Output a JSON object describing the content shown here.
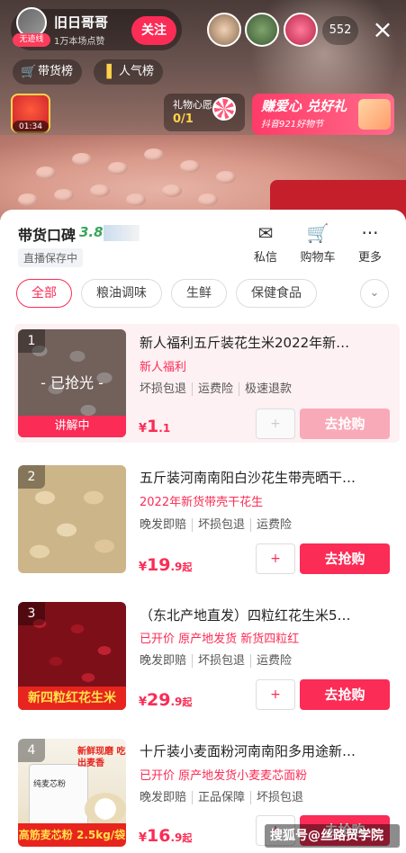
{
  "live": {
    "anchor_name": "旧日哥哥",
    "anchor_badge": "无迹线",
    "fans": "1万本场点赞",
    "follow_label": "关注",
    "viewer_count": "552",
    "close_icon": "×",
    "pills": [
      {
        "label": "带货榜",
        "icon": "cart-icon"
      },
      {
        "label": "人气榜",
        "icon": "bars-icon"
      }
    ],
    "redbag_time": "01:34",
    "wish": {
      "label": "礼物心愿",
      "count": "0/1"
    },
    "promo": {
      "title": "赚爱心 兑好礼",
      "sub": "抖音921好物节"
    }
  },
  "panel": {
    "title": "带货口碑",
    "score": "3.8",
    "subtitle": "直播保存中",
    "tools": [
      {
        "label": "私信",
        "icon": "message-icon",
        "glyph": "✉"
      },
      {
        "label": "购物车",
        "icon": "cart-icon",
        "glyph": "🛒"
      },
      {
        "label": "更多",
        "icon": "more-icon",
        "glyph": "···"
      }
    ],
    "categories": [
      {
        "label": "全部",
        "active": true
      },
      {
        "label": "粮油调味",
        "active": false
      },
      {
        "label": "生鲜",
        "active": false
      },
      {
        "label": "保健食品",
        "active": false
      }
    ],
    "expand_icon": "⌄"
  },
  "products": [
    {
      "index": "1",
      "title": "新人福利五斤装花生米2022年新…",
      "label": "新人福利",
      "tags": [
        "坏损包退",
        "运费险",
        "极速退款"
      ],
      "price_currency": "¥",
      "price_int": "1",
      "price_dec": ".1",
      "price_suffix": "",
      "overlay": "- 已抢光 -",
      "explain": "讲解中",
      "buy_label": "去抢购",
      "sold_out": true,
      "add_icon": "+"
    },
    {
      "index": "2",
      "title": "五斤装河南南阳白沙花生带壳晒干…",
      "label": "2022年新货带壳干花生",
      "tags": [
        "晚发即赔",
        "坏损包退",
        "运费险"
      ],
      "price_currency": "¥",
      "price_int": "19",
      "price_dec": ".9",
      "price_suffix": "起",
      "buy_label": "去抢购",
      "sold_out": false,
      "add_icon": "+"
    },
    {
      "index": "3",
      "title": "（东北产地直发）四粒红花生米5…",
      "label": "已开价 原产地发货 新货四粒红",
      "tags": [
        "晚发即赔",
        "坏损包退",
        "运费险"
      ],
      "price_currency": "¥",
      "price_int": "29",
      "price_dec": ".9",
      "price_suffix": "起",
      "bottom_tag": "新四粒红花生米",
      "buy_label": "去抢购",
      "sold_out": false,
      "add_icon": "+"
    },
    {
      "index": "4",
      "title": "十斤装小麦面粉河南南阳多用途新…",
      "label": "已开价 原产地发货小麦麦芯面粉",
      "tags": [
        "晚发即赔",
        "正品保障",
        "坏损包退"
      ],
      "price_currency": "¥",
      "price_int": "16",
      "price_dec": ".9",
      "price_suffix": "起",
      "bottom_tag": "高筋麦芯粉 2.5kg/袋",
      "callout": "新鲜现磨 吃出麦香",
      "bag_text": "纯麦芯粉",
      "buy_label": "去抢购",
      "sold_out": false,
      "add_icon": "+"
    }
  ],
  "watermark": "搜狐号@丝路贸学院"
}
